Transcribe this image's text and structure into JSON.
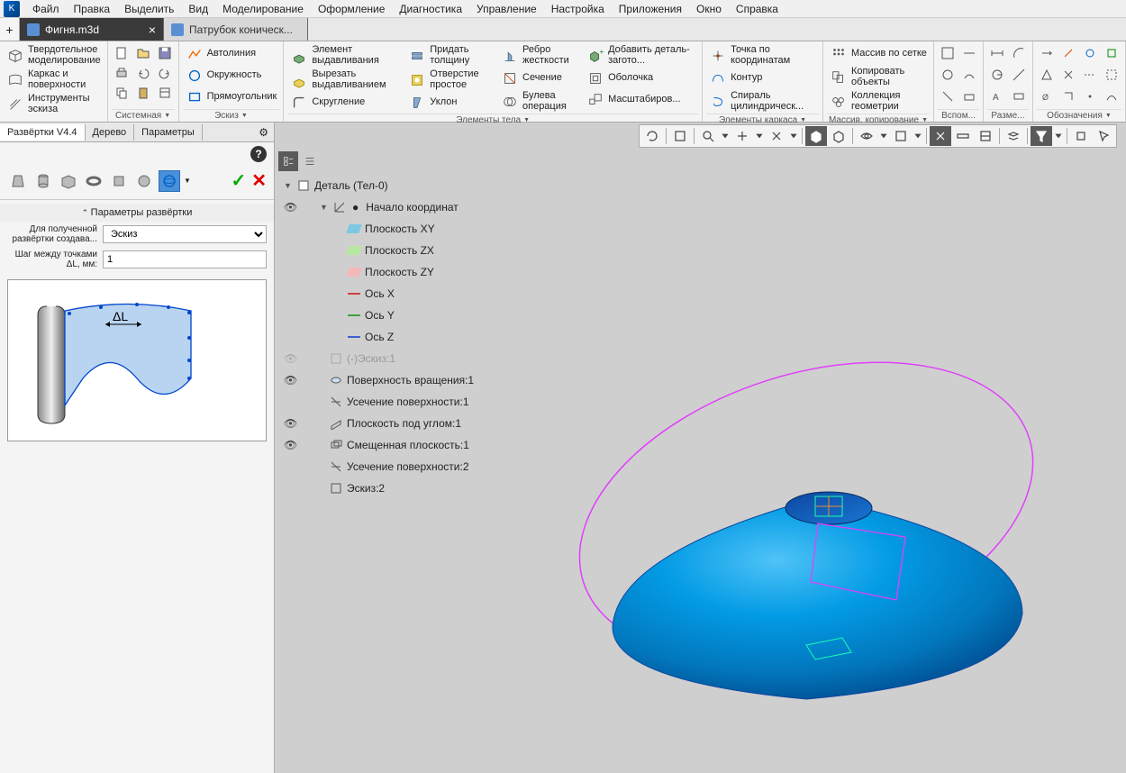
{
  "menu": [
    "Файл",
    "Правка",
    "Выделить",
    "Вид",
    "Моделирование",
    "Оформление",
    "Диагностика",
    "Управление",
    "Настройка",
    "Приложения",
    "Окно",
    "Справка"
  ],
  "tabs": {
    "active": {
      "label": "Фигня.m3d"
    },
    "inactive": {
      "label": "Патрубок коническ..."
    }
  },
  "ribbon": {
    "g1": {
      "solid": "Твердотельное моделирование",
      "wireframe": "Каркас и поверхности",
      "sketch": "Инструменты эскиза"
    },
    "g2": {
      "footer": "Системная"
    },
    "g3": {
      "autoline": "Автолиния",
      "circle": "Окружность",
      "rect": "Прямоугольник",
      "footer": "Эскиз"
    },
    "g4": {
      "extrude": "Элемент выдавливания",
      "cut": "Вырезать выдавливанием",
      "fillet": "Скругление",
      "footer": "Элементы тела"
    },
    "g5": {
      "thick": "Придать толщину",
      "hole": "Отверстие простое",
      "slope": "Уклон"
    },
    "g6": {
      "rib": "Ребро жесткости",
      "section": "Сечение",
      "bool": "Булева операция"
    },
    "g7": {
      "addpart": "Добавить деталь-загото...",
      "shell": "Оболочка",
      "scale": "Масштабиров..."
    },
    "g8": {
      "point": "Точка по координатам",
      "contour": "Контур",
      "spiral": "Спираль цилиндрическ...",
      "footer": "Элементы каркаса"
    },
    "g9": {
      "array": "Массив по сетке",
      "copy": "Копировать объекты",
      "collection": "Коллекция геометрии",
      "footer": "Массив, копирование"
    },
    "g10": {
      "footer": "Вспом..."
    },
    "g11": {
      "footer": "Разме..."
    },
    "g12": {
      "footer": "Обозначения"
    }
  },
  "side": {
    "tab1": "Развёртки V4.4",
    "tab2": "Дерево",
    "tab3": "Параметры",
    "param_head": "Параметры развёртки",
    "label1": "Для полученной развёртки создава...",
    "value1": "Эскиз",
    "label2": "Шаг между точками ΔL, мм:",
    "value2": "1",
    "preview_label": "ΔL"
  },
  "tree": {
    "root": "Деталь (Тел-0)",
    "origin": "Начало координат",
    "pxy": "Плоскость XY",
    "pzx": "Плоскость ZX",
    "pzy": "Плоскость ZY",
    "ax": "Ось X",
    "ay": "Ось Y",
    "az": "Ось Z",
    "sk1": "(-)Эскиз:1",
    "rev": "Поверхность вращения:1",
    "trim1": "Усечение поверхности:1",
    "ang": "Плоскость под углом:1",
    "off": "Смещенная плоскость:1",
    "trim2": "Усечение поверхности:2",
    "sk2": "Эскиз:2"
  }
}
